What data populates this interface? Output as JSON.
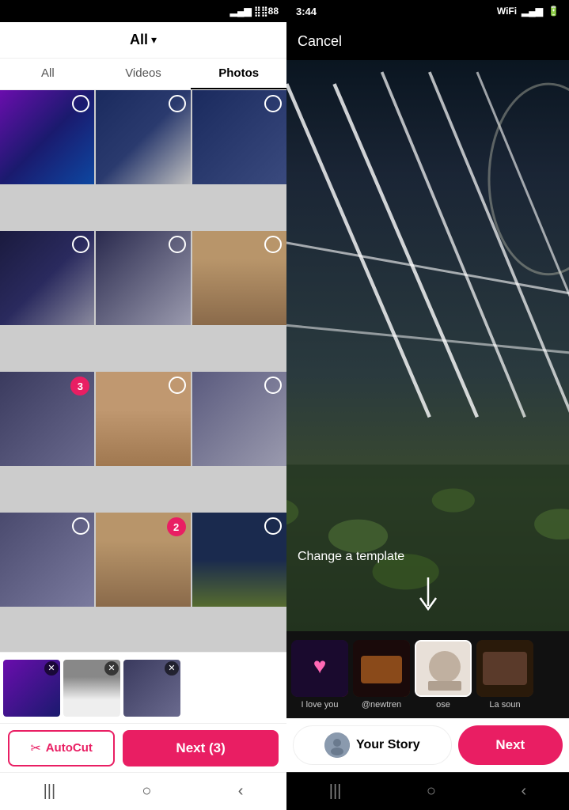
{
  "left": {
    "status": {
      "battery": "88"
    },
    "header": {
      "title": "All",
      "chevron": "▾"
    },
    "tabs": [
      {
        "label": "All",
        "active": false
      },
      {
        "label": "Videos",
        "active": false
      },
      {
        "label": "Photos",
        "active": true
      }
    ],
    "selectedStrip": {
      "items": [
        {
          "id": 1,
          "bg": "thumb-bg-1"
        },
        {
          "id": 2,
          "bg": "thumb-bg-2"
        },
        {
          "id": 3,
          "bg": "thumb-bg-3"
        }
      ]
    },
    "bottomBar": {
      "autocutLabel": "AutoCut",
      "nextLabel": "Next (3)"
    },
    "nav": {
      "back": "|||",
      "home": "○",
      "recent": "‹"
    }
  },
  "right": {
    "statusBar": {
      "time": "3:44"
    },
    "topBar": {
      "cancelLabel": "Cancel"
    },
    "mainImage": {
      "changeTemplateLabel": "Change a template"
    },
    "templates": [
      {
        "label": "I love you",
        "bg": "tmpl-1",
        "selected": false
      },
      {
        "label": "@newtren",
        "bg": "tmpl-2",
        "selected": false
      },
      {
        "label": "ose",
        "bg": "tmpl-3",
        "selected": true
      },
      {
        "label": "La soun",
        "bg": "tmpl-4",
        "selected": false
      }
    ],
    "bottomBar": {
      "yourStoryLabel": "Your Story",
      "nextLabel": "Next"
    },
    "nav": {
      "back": "|||",
      "home": "○",
      "recent": "‹"
    }
  }
}
